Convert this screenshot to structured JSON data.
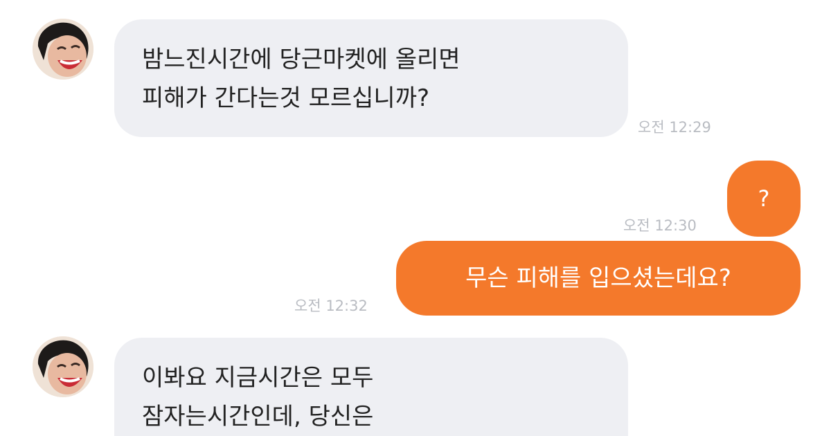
{
  "messages": [
    {
      "direction": "incoming",
      "lines": [
        "밤느진시간에  당근마켓에 올리면",
        "피해가 간다는것 모르십니까?"
      ],
      "time": "오전 12:29"
    },
    {
      "direction": "outgoing",
      "lines": [
        "?"
      ],
      "time": "오전 12:30"
    },
    {
      "direction": "outgoing",
      "lines": [
        "무슨 피해를 입으셨는데요?"
      ],
      "time": "오전 12:32"
    },
    {
      "direction": "incoming",
      "lines": [
        "이봐요 지금시간은 모두",
        "잠자는시간인데, 당신은"
      ],
      "time": ""
    }
  ],
  "icons": {
    "sender_avatar": "laughing-face-avatar-icon"
  },
  "colors": {
    "incoming_bubble": "#eeeff3",
    "outgoing_bubble": "#f4792b",
    "timestamp": "#b9bcc2"
  }
}
